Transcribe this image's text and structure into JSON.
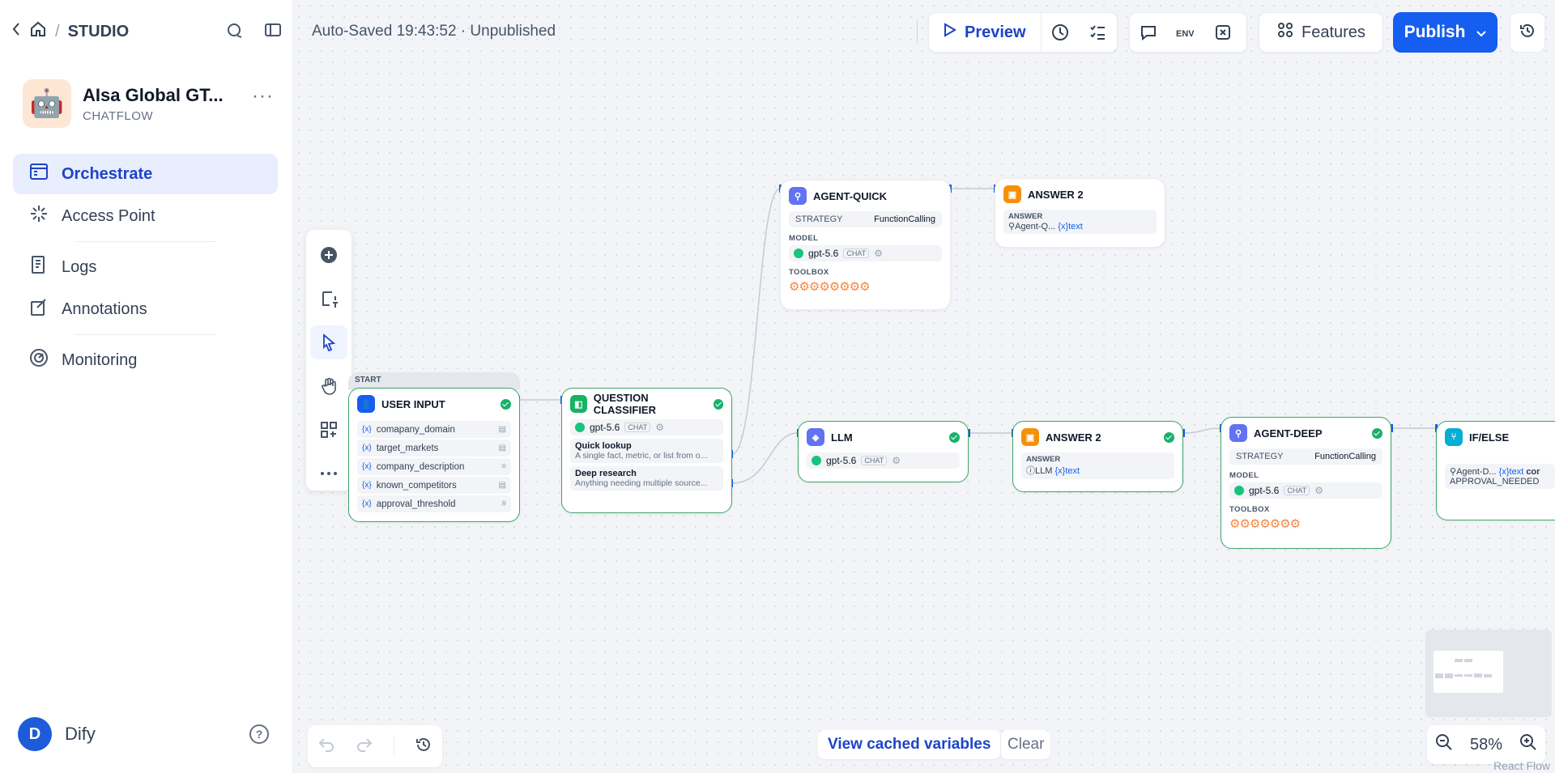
{
  "topbar": {
    "studio_label": "STUDIO"
  },
  "app": {
    "name": "AIsa Global GT...",
    "type": "CHATFLOW",
    "icon": "robot-icon"
  },
  "nav": {
    "items": [
      {
        "label": "Orchestrate",
        "icon": "orchestrate-icon",
        "active": true
      },
      {
        "label": "Access Point",
        "icon": "access-point-icon"
      },
      {
        "label": "Logs",
        "icon": "logs-icon"
      },
      {
        "label": "Annotations",
        "icon": "annotations-icon"
      },
      {
        "label": "Monitoring",
        "icon": "monitoring-icon"
      }
    ]
  },
  "user": {
    "initial": "D",
    "name": "Dify"
  },
  "header": {
    "status": "Auto-Saved 19:43:52 · Unpublished",
    "preview_label": "Preview",
    "features_label": "Features",
    "publish_label": "Publish"
  },
  "nodes": {
    "start": {
      "tag": "START",
      "title": "USER INPUT",
      "vars": [
        "comapany_domain",
        "target_markets",
        "company_description",
        "known_competitors",
        "approval_threshold"
      ],
      "var_type_icons": [
        "▤",
        "▤",
        "≡",
        "▤",
        "#"
      ]
    },
    "classifier": {
      "title": "QUESTION CLASSIFIER",
      "model": "gpt-5.6",
      "model_tag": "CHAT",
      "classes": [
        {
          "name": "Quick lookup",
          "desc": "A single fact, metric, or list from o..."
        },
        {
          "name": "Deep research",
          "desc": "Anything needing multiple source..."
        }
      ]
    },
    "agent_quick": {
      "title": "AGENT-QUICK",
      "strategy_label": "STRATEGY",
      "strategy": "FunctionCalling",
      "model_label": "MODEL",
      "model": "gpt-5.6",
      "model_tag": "CHAT",
      "toolbox_label": "TOOLBOX",
      "toolbox": "⚙⚙⚙⚙⚙⚙⚙⚙"
    },
    "answer_top": {
      "title": "ANSWER 2",
      "answer_label": "ANSWER",
      "answer_src": "Agent-Q...",
      "answer_var": "text"
    },
    "llm": {
      "title": "LLM",
      "model": "gpt-5.6",
      "model_tag": "CHAT"
    },
    "answer_mid": {
      "title": "ANSWER 2",
      "answer_label": "ANSWER",
      "answer_src": "LLM",
      "answer_var": "text"
    },
    "agent_deep": {
      "title": "AGENT-DEEP",
      "strategy_label": "STRATEGY",
      "strategy": "FunctionCalling",
      "model_label": "MODEL",
      "model": "gpt-5.6",
      "model_tag": "CHAT",
      "toolbox_label": "TOOLBOX",
      "toolbox": "⚙⚙⚙⚙⚙⚙⚙"
    },
    "ifelse": {
      "title": "IF/ELSE",
      "cond_src": "Agent-D...",
      "cond_var": "text",
      "cond_op": "cor",
      "cond_value": "APPROVAL_NEEDED"
    }
  },
  "footer": {
    "cached_label": "View cached variables",
    "clear_label": "Clear",
    "zoom": "58%",
    "reactflow": "React Flow"
  },
  "colors": {
    "accent": "#155eef",
    "success": "#17b26a",
    "agent": "#6172f3",
    "answer": "#f79009",
    "classifier": "#16b364",
    "ifelse": "#06aed4"
  }
}
